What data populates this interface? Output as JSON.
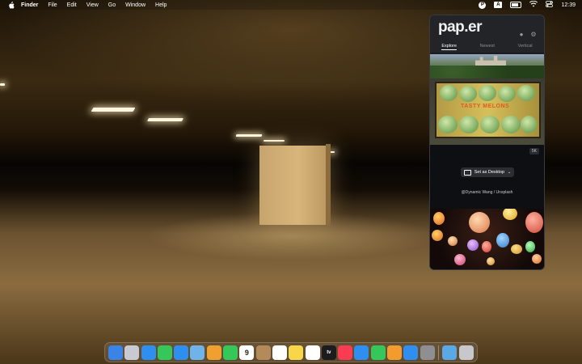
{
  "menubar": {
    "app_name": "Finder",
    "items": [
      "File",
      "Edit",
      "View",
      "Go",
      "Window",
      "Help"
    ],
    "status": {
      "paper_letter": "P",
      "keyboard_letter": "A",
      "time": "12:39"
    }
  },
  "panel": {
    "logo": "pap.er",
    "tabs": [
      "Explore",
      "Newest",
      "Vertical"
    ],
    "active_tab": "Explore",
    "crate_text": "TASTY MELONS",
    "badge": "5K",
    "set_desktop_label": "Set as Desktop",
    "credit": "@Dynamic Wang / Unsplash"
  },
  "dock": {
    "calendar_day": "9",
    "tv_label": "tv",
    "items": [
      {
        "name": "finder",
        "color": "#3a84e8"
      },
      {
        "name": "launchpad",
        "color": "#c9c9d2"
      },
      {
        "name": "safari",
        "color": "#2f8ff0"
      },
      {
        "name": "messages",
        "color": "#35c759"
      },
      {
        "name": "mail",
        "color": "#2f8ff0"
      },
      {
        "name": "maps",
        "color": "#6fb3e8"
      },
      {
        "name": "photos",
        "color": "#f0a030"
      },
      {
        "name": "facetime",
        "color": "#34c759"
      },
      {
        "name": "calendar",
        "color": "#ffffff"
      },
      {
        "name": "contacts",
        "color": "#b48a5a"
      },
      {
        "name": "reminders",
        "color": "#ffffff"
      },
      {
        "name": "notes",
        "color": "#f7d64a"
      },
      {
        "name": "freeform",
        "color": "#ffffff"
      },
      {
        "name": "tv",
        "color": "#1c1c1e"
      },
      {
        "name": "music",
        "color": "#fa3c52"
      },
      {
        "name": "keynote",
        "color": "#2f8ff0"
      },
      {
        "name": "numbers",
        "color": "#34c759"
      },
      {
        "name": "pages",
        "color": "#f49b2e"
      },
      {
        "name": "app-store",
        "color": "#2f8ff0"
      },
      {
        "name": "system-settings",
        "color": "#8e8e93"
      },
      {
        "name": "downloads-folder",
        "color": "#5aa9e6"
      },
      {
        "name": "trash",
        "color": "#c7c7cc"
      }
    ]
  }
}
